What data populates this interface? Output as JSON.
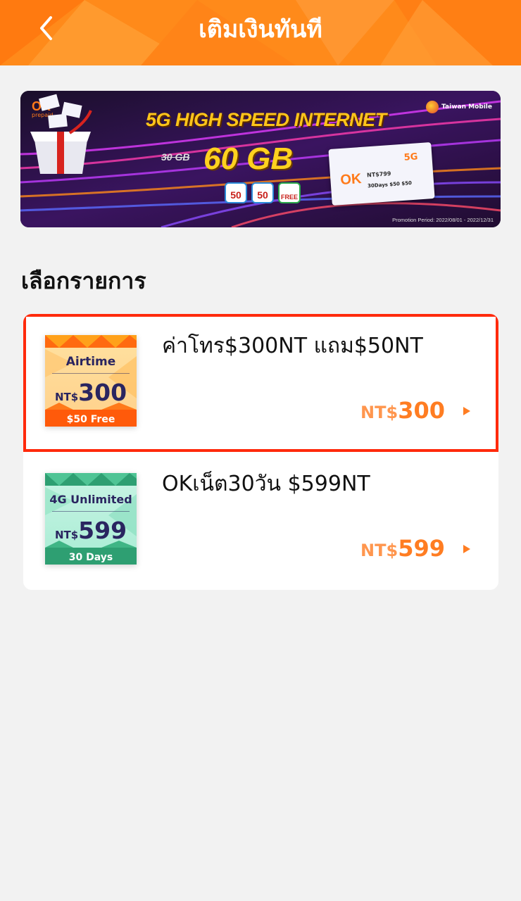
{
  "header": {
    "title": "เติมเงินทันที",
    "back_icon": "chevron-left-icon"
  },
  "banner": {
    "brand": "OK",
    "brand_sub": "prepaid",
    "carrier": "Taiwan Mobile",
    "headline": "5G HIGH SPEED INTERNET",
    "old_data": "30 GB",
    "new_data": "60 GB",
    "badges": [
      "50",
      "50",
      "FREE"
    ],
    "card_price": "NT$799",
    "card_tag": "5G",
    "card_days": "30Days $50 $50",
    "promo": "Promotion Period: 2022/08/01 - 2022/12/31"
  },
  "section_title": "เลือกรายการ",
  "items": [
    {
      "name": "ค่าโทร$300NT แถม$50NT",
      "thumb_title": "Airtime",
      "thumb_currency": "NT$",
      "thumb_amount": "300",
      "thumb_footer": "$50 Free",
      "price_currency": "NT$",
      "price_amount": "300",
      "selected": true
    },
    {
      "name": "OKเน็ต30วัน $599NT",
      "thumb_title": "4G Unlimited",
      "thumb_currency": "NT$",
      "thumb_amount": "599",
      "thumb_footer": "30 Days",
      "price_currency": "NT$",
      "price_amount": "599",
      "selected": false
    }
  ],
  "colors": {
    "header": "#ff8a1a",
    "accent_price": "#ff7d22",
    "selection_border": "#ff2a0c",
    "airtime_band": "#ff5a0a",
    "unlimited_band": "#2e9f72"
  }
}
